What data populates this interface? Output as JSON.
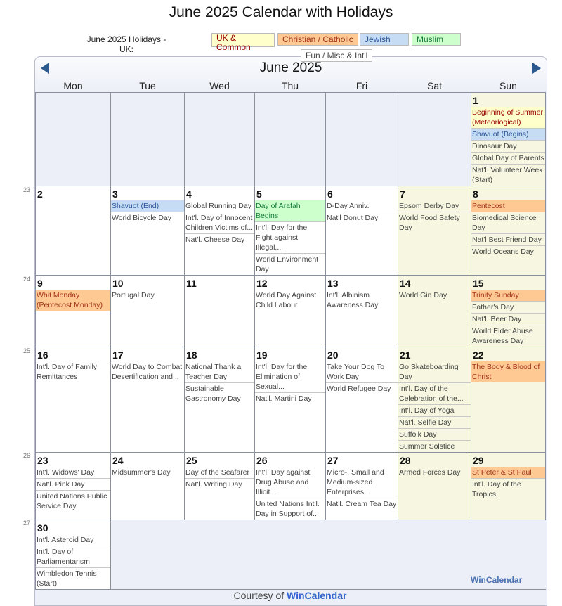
{
  "title": "June 2025 Calendar with Holidays",
  "legend": {
    "label": "June 2025 Holidays - UK:",
    "items": [
      {
        "label": "UK & Common",
        "type": "uk"
      },
      {
        "label": "Christian / Catholic",
        "type": "chr"
      },
      {
        "label": "Jewish",
        "type": "jew"
      },
      {
        "label": "Muslim",
        "type": "mus"
      },
      {
        "label": "Fun / Misc & Int'l",
        "type": "fun"
      }
    ]
  },
  "colors": {
    "uk": "#ffffcc",
    "chr": "#ffc993",
    "jew": "#c6dcf5",
    "mus": "#ccffcc",
    "weekend": "#f7f7e1",
    "nav": "#2d5a8e"
  },
  "calendar": {
    "month": "June 2025",
    "prev_icon": "triangle-left",
    "next_icon": "triangle-right",
    "weekdays": [
      "Mon",
      "Tue",
      "Wed",
      "Thu",
      "Fri",
      "Sat",
      "Sun"
    ],
    "weeks": [
      {
        "week": "",
        "days": [
          null,
          null,
          null,
          null,
          null,
          null,
          {
            "day": "1",
            "events": [
              {
                "name": "Beginning of Summer (Meteorlogical)",
                "type": "uk"
              },
              {
                "name": "Shavuot (Begins)",
                "type": "jew"
              },
              {
                "name": "Dinosaur Day",
                "type": "fun"
              },
              {
                "name": "Global Day of Parents",
                "type": "fun"
              },
              {
                "name": "Nat'l. Volunteer Week (Start)",
                "type": "fun"
              }
            ]
          }
        ]
      },
      {
        "week": "23",
        "days": [
          {
            "day": "2",
            "events": []
          },
          {
            "day": "3",
            "events": [
              {
                "name": "Shavuot (End)",
                "type": "jew"
              },
              {
                "name": "World Bicycle Day",
                "type": "fun"
              }
            ]
          },
          {
            "day": "4",
            "events": [
              {
                "name": "Global Running Day",
                "type": "fun"
              },
              {
                "name": "Int'l. Day of Innocent Children Victims of...",
                "type": "fun"
              },
              {
                "name": "Nat'l. Cheese Day",
                "type": "fun"
              }
            ]
          },
          {
            "day": "5",
            "events": [
              {
                "name": "Day of Arafah Begins",
                "type": "mus"
              },
              {
                "name": "Int'l. Day for the Fight against Illegal,...",
                "type": "fun"
              },
              {
                "name": "World Environment Day",
                "type": "fun"
              }
            ]
          },
          {
            "day": "6",
            "events": [
              {
                "name": "D-Day Anniv.",
                "type": "fun"
              },
              {
                "name": "Nat'l Donut Day",
                "type": "fun"
              }
            ]
          },
          {
            "day": "7",
            "events": [
              {
                "name": "Epsom Derby Day",
                "type": "fun"
              },
              {
                "name": "World Food Safety Day",
                "type": "fun"
              }
            ]
          },
          {
            "day": "8",
            "events": [
              {
                "name": "Pentecost",
                "type": "chr"
              },
              {
                "name": "Biomedical Science Day",
                "type": "fun"
              },
              {
                "name": "Nat'l Best Friend Day",
                "type": "fun"
              },
              {
                "name": "World Oceans Day",
                "type": "fun"
              }
            ]
          }
        ]
      },
      {
        "week": "24",
        "days": [
          {
            "day": "9",
            "events": [
              {
                "name": "Whit Monday (Pentecost Monday)",
                "type": "chr"
              }
            ]
          },
          {
            "day": "10",
            "events": [
              {
                "name": "Portugal Day",
                "type": "fun"
              }
            ]
          },
          {
            "day": "11",
            "events": []
          },
          {
            "day": "12",
            "events": [
              {
                "name": "World Day Against Child Labour",
                "type": "fun"
              }
            ]
          },
          {
            "day": "13",
            "events": [
              {
                "name": "Int'l. Albinism Awareness Day",
                "type": "fun"
              }
            ]
          },
          {
            "day": "14",
            "events": [
              {
                "name": "World Gin Day",
                "type": "fun"
              }
            ]
          },
          {
            "day": "15",
            "events": [
              {
                "name": "Trinity Sunday",
                "type": "chr"
              },
              {
                "name": "Father's Day",
                "type": "fun"
              },
              {
                "name": "Nat'l. Beer Day",
                "type": "fun"
              },
              {
                "name": "World Elder Abuse Awareness Day",
                "type": "fun"
              }
            ]
          }
        ]
      },
      {
        "week": "25",
        "days": [
          {
            "day": "16",
            "events": [
              {
                "name": "Int'l. Day of Family Remittances",
                "type": "fun"
              }
            ]
          },
          {
            "day": "17",
            "events": [
              {
                "name": "World Day to Combat Desertification and...",
                "type": "fun"
              }
            ]
          },
          {
            "day": "18",
            "events": [
              {
                "name": "National Thank a Teacher Day",
                "type": "fun"
              },
              {
                "name": "Sustainable Gastronomy Day",
                "type": "fun"
              }
            ]
          },
          {
            "day": "19",
            "events": [
              {
                "name": "Int'l. Day for the Elimination of Sexual...",
                "type": "fun"
              },
              {
                "name": "Nat'l. Martini Day",
                "type": "fun"
              }
            ]
          },
          {
            "day": "20",
            "events": [
              {
                "name": "Take Your Dog To Work Day",
                "type": "fun"
              },
              {
                "name": "World Refugee Day",
                "type": "fun"
              }
            ]
          },
          {
            "day": "21",
            "events": [
              {
                "name": "Go Skateboarding Day",
                "type": "fun"
              },
              {
                "name": "Int'l. Day of the Celebration of the...",
                "type": "fun"
              },
              {
                "name": "Int'l. Day of Yoga",
                "type": "fun"
              },
              {
                "name": "Nat'l. Selfie Day",
                "type": "fun"
              },
              {
                "name": "Suffolk Day",
                "type": "fun"
              },
              {
                "name": "Summer Solstice",
                "type": "fun"
              }
            ]
          },
          {
            "day": "22",
            "events": [
              {
                "name": "The Body & Blood of Christ",
                "type": "chr"
              }
            ]
          }
        ]
      },
      {
        "week": "26",
        "days": [
          {
            "day": "23",
            "events": [
              {
                "name": "Int'l. Widows' Day",
                "type": "fun"
              },
              {
                "name": "Nat'l. Pink Day",
                "type": "fun"
              },
              {
                "name": "United Nations Public Service Day",
                "type": "fun"
              }
            ]
          },
          {
            "day": "24",
            "events": [
              {
                "name": "Midsummer's Day",
                "type": "fun"
              }
            ]
          },
          {
            "day": "25",
            "events": [
              {
                "name": "Day of the Seafarer",
                "type": "fun"
              },
              {
                "name": "Nat'l. Writing Day",
                "type": "fun"
              }
            ]
          },
          {
            "day": "26",
            "events": [
              {
                "name": "Int'l. Day against Drug Abuse and Illicit...",
                "type": "fun"
              },
              {
                "name": "United Nations Int'l. Day in Support of...",
                "type": "fun"
              }
            ]
          },
          {
            "day": "27",
            "events": [
              {
                "name": "Micro-, Small and Medium-sized Enterprises...",
                "type": "fun"
              },
              {
                "name": "Nat'l. Cream Tea Day",
                "type": "fun"
              }
            ]
          },
          {
            "day": "28",
            "events": [
              {
                "name": "Armed Forces Day",
                "type": "fun"
              }
            ]
          },
          {
            "day": "29",
            "events": [
              {
                "name": "St Peter & St Paul",
                "type": "chr"
              },
              {
                "name": "Int'l. Day of the Tropics",
                "type": "fun"
              }
            ]
          }
        ]
      },
      {
        "week": "27",
        "days": [
          {
            "day": "30",
            "events": [
              {
                "name": "Int'l. Asteroid Day",
                "type": "fun"
              },
              {
                "name": "Int'l. Day of Parliamentarism",
                "type": "fun"
              },
              {
                "name": "Wimbledon Tennis (Start)",
                "type": "fun"
              }
            ]
          },
          null,
          null,
          null,
          null,
          null,
          null
        ]
      }
    ]
  },
  "footer": {
    "brand": "WinCalendar",
    "courtesy_prefix": "Courtesy of ",
    "courtesy_link": "WinCalendar"
  }
}
